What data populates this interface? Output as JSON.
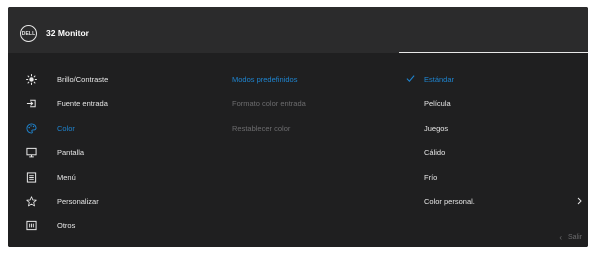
{
  "header": {
    "logo_text": "DELL",
    "title": "32 Monitor"
  },
  "colors": {
    "accent": "#1e84cf",
    "text": "#e8e8e8",
    "dim": "#6c6c6e",
    "header_bg": "#2b2b2c",
    "panel_bg": "#1f1f20"
  },
  "main_menu": [
    {
      "label": "Brillo/Contraste",
      "icon": "brightness-icon"
    },
    {
      "label": "Fuente entrada",
      "icon": "input-source-icon"
    },
    {
      "label": "Color",
      "icon": "color-palette-icon",
      "active": true
    },
    {
      "label": "Pantalla",
      "icon": "display-icon"
    },
    {
      "label": "Menú",
      "icon": "menu-icon"
    },
    {
      "label": "Personalizar",
      "icon": "star-icon"
    },
    {
      "label": "Otros",
      "icon": "others-icon"
    }
  ],
  "sub_menu": [
    {
      "label": "Modos predefinidos",
      "state": "active"
    },
    {
      "label": "Formato color entrada",
      "state": "disabled"
    },
    {
      "label": "Restablecer color",
      "state": "disabled"
    }
  ],
  "options": [
    {
      "label": "Estándar",
      "selected": true
    },
    {
      "label": "Película"
    },
    {
      "label": "Juegos"
    },
    {
      "label": "Cálido"
    },
    {
      "label": "Frío"
    },
    {
      "label": "Color personal.",
      "has_submenu": true
    }
  ],
  "footer": {
    "exit_label": "Salir"
  }
}
